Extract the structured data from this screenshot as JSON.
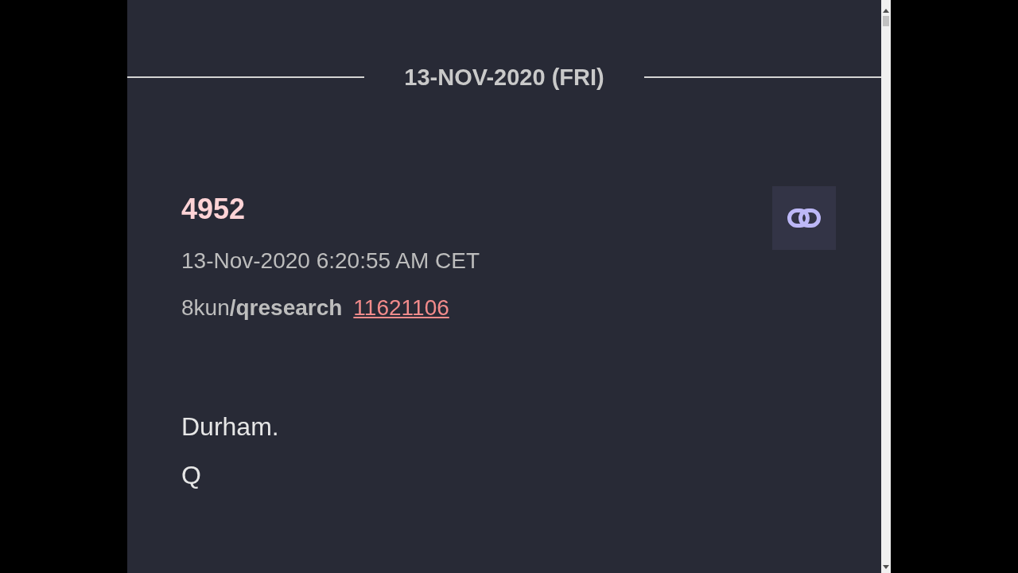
{
  "date_heading": "13-NOV-2020 (FRI)",
  "post": {
    "number": "4952",
    "timestamp": "13-Nov-2020 6:20:55 AM CET",
    "source": "8kun**/qresearch**",
    "post_link": "11621106",
    "body": [
      "Durham.",
      "Q"
    ]
  }
}
